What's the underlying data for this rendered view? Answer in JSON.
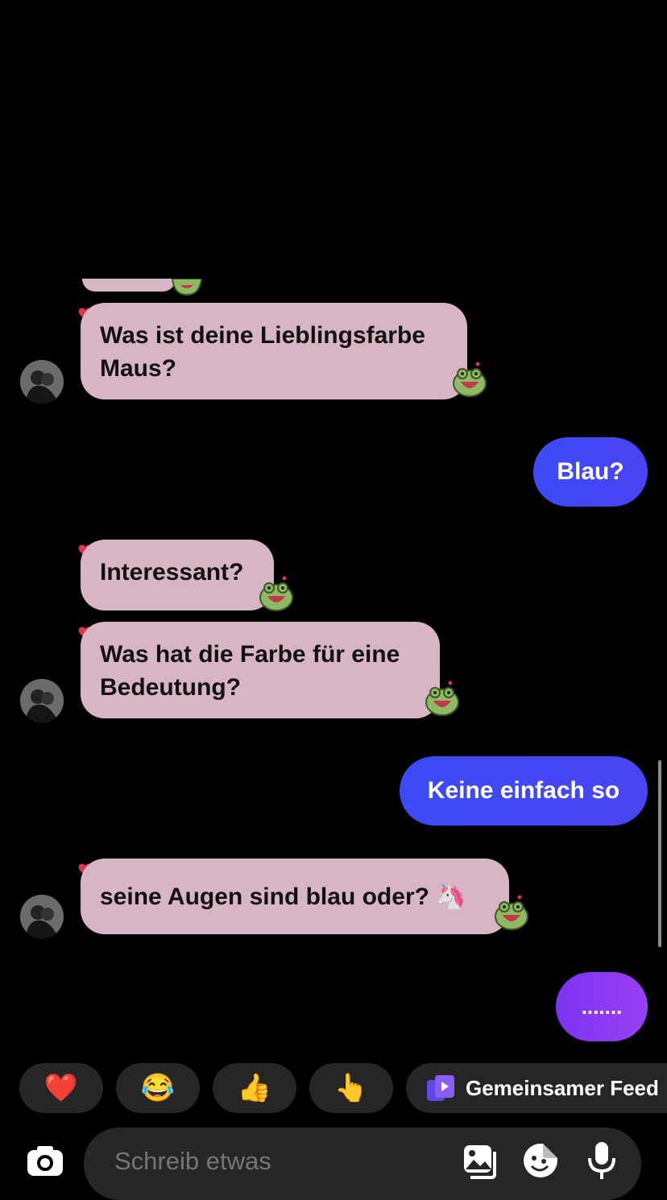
{
  "messages": {
    "m1": "Was ist deine Lieblingsfarbe Maus?",
    "m2": "Blau?",
    "m3": "Interessant?",
    "m4": "Was hat die Farbe für eine Bedeutung?",
    "m5": "Keine einfach so",
    "m6": "seine Augen sind blau oder? 🦄",
    "m7": "......."
  },
  "quick_reactions": [
    "❤️",
    "😂",
    "👍",
    "👆"
  ],
  "shared_feed_label": "Gemeinsamer Feed",
  "composer": {
    "placeholder": "Schreib etwas"
  },
  "colors": {
    "incoming_bubble": "#d8b5c4",
    "outgoing_bubble": "#3b4bf5",
    "typing_bubble": "#8a3df2",
    "background": "#000000",
    "pill": "#262626"
  }
}
